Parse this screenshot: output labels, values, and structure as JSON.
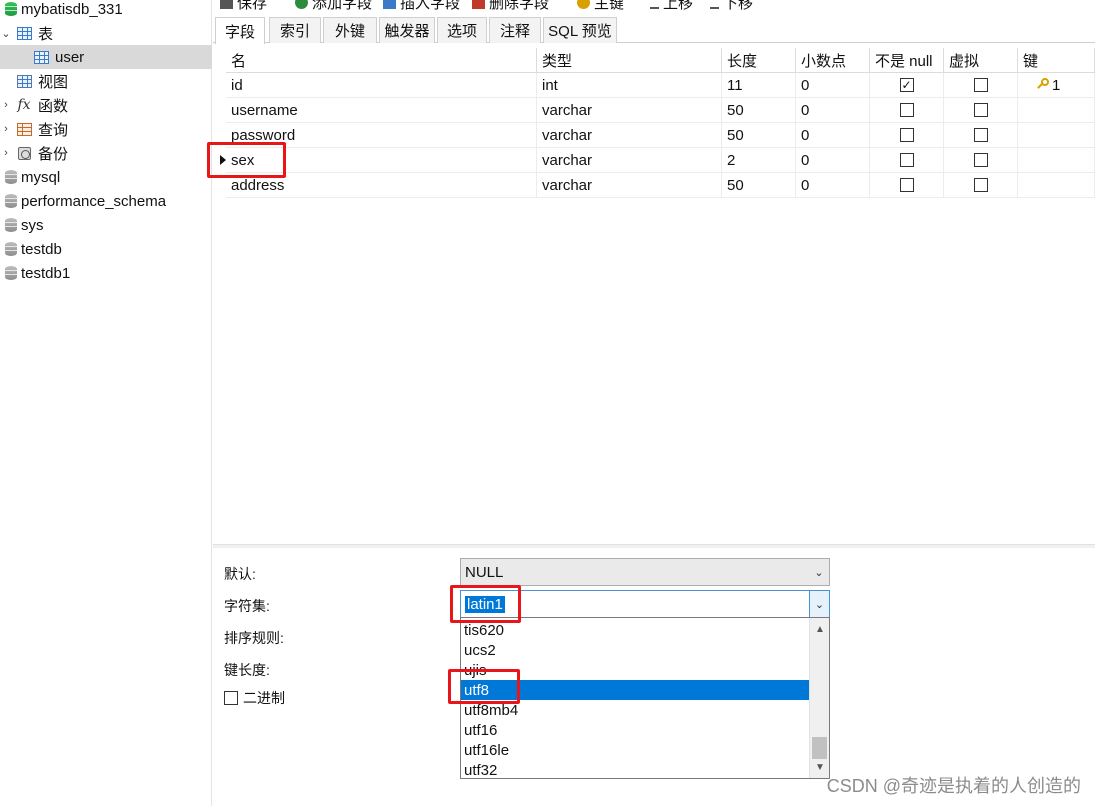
{
  "sidebar": {
    "items": [
      {
        "label": "mybatisdb_331",
        "icon": "database-icon"
      },
      {
        "label": "表",
        "icon": "table-icon"
      },
      {
        "label": "user",
        "icon": "table-icon"
      },
      {
        "label": "视图",
        "icon": "view-icon"
      },
      {
        "label": "函数",
        "icon": "function-icon"
      },
      {
        "label": "查询",
        "icon": "query-icon"
      },
      {
        "label": "备份",
        "icon": "backup-icon"
      },
      {
        "label": "mysql",
        "icon": "database-icon"
      },
      {
        "label": "performance_schema",
        "icon": "database-icon"
      },
      {
        "label": "sys",
        "icon": "database-icon"
      },
      {
        "label": "testdb",
        "icon": "database-icon"
      },
      {
        "label": "testdb1",
        "icon": "database-icon"
      }
    ]
  },
  "toolbar": {
    "save": "保存",
    "add_field": "添加字段",
    "insert_field": "插入字段",
    "delete_field": "删除字段",
    "primary_key": "主键",
    "move_up": "上移",
    "move_down": "下移"
  },
  "tabs": [
    "字段",
    "索引",
    "外键",
    "触发器",
    "选项",
    "注释",
    "SQL 预览"
  ],
  "grid": {
    "columns": [
      "名",
      "类型",
      "长度",
      "小数点",
      "不是 null",
      "虚拟",
      "键"
    ],
    "rows": [
      {
        "name": "id",
        "type": "int",
        "length": "11",
        "decimals": "0",
        "not_null": true,
        "virtual": false,
        "key": "1"
      },
      {
        "name": "username",
        "type": "varchar",
        "length": "50",
        "decimals": "0",
        "not_null": false,
        "virtual": false,
        "key": ""
      },
      {
        "name": "password",
        "type": "varchar",
        "length": "50",
        "decimals": "0",
        "not_null": false,
        "virtual": false,
        "key": ""
      },
      {
        "name": "sex",
        "type": "varchar",
        "length": "2",
        "decimals": "0",
        "not_null": false,
        "virtual": false,
        "key": ""
      },
      {
        "name": "address",
        "type": "varchar",
        "length": "50",
        "decimals": "0",
        "not_null": false,
        "virtual": false,
        "key": ""
      }
    ],
    "current_row": "sex"
  },
  "properties": {
    "default_label": "默认:",
    "default_value": "NULL",
    "charset_label": "字符集:",
    "charset_value": "latin1",
    "collation_label": "排序规则:",
    "key_length_label": "键长度:",
    "binary_label": "二进制",
    "binary_checked": false
  },
  "charset_options": [
    "tis620",
    "ucs2",
    "ujis",
    "utf8",
    "utf8mb4",
    "utf16",
    "utf16le",
    "utf32"
  ],
  "charset_highlighted": "utf8",
  "watermark": "CSDN @奇迹是执着的人创造的",
  "colors": {
    "accent": "#0078d7",
    "annotation": "#e8161b",
    "key": "#d9a000",
    "db_active": "#1f9a3f"
  }
}
